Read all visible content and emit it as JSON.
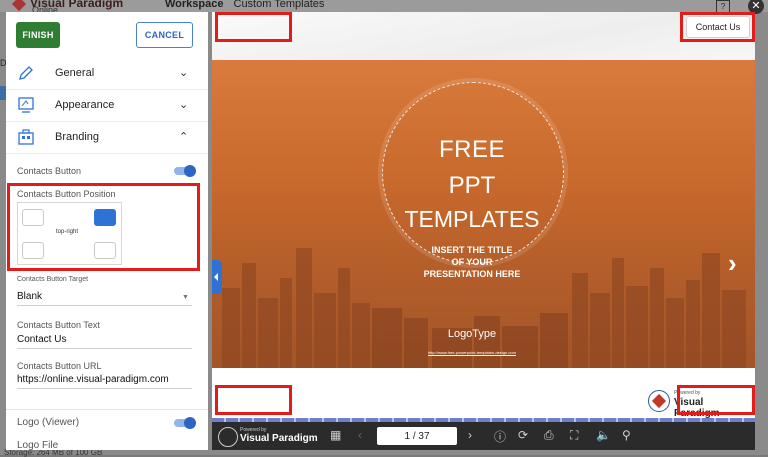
{
  "background": {
    "logo_name": "Visual Paradigm",
    "logo_sub": "Online",
    "workspace_label": "Workspace",
    "crumb": "Custom Templates",
    "help": "?",
    "close": "✕",
    "storage": "Storage: 264 MB of 100 GB",
    "left_letter": "D"
  },
  "panel": {
    "finish_label": "FINISH",
    "cancel_label": "CANCEL",
    "sections": {
      "general": "General",
      "appearance": "Appearance",
      "branding": "Branding"
    },
    "contacts_button_label": "Contacts Button",
    "contacts_button_on": true,
    "position_label": "Contacts Button Position",
    "position_value": "top-right",
    "target_label": "Contacts Button Target",
    "target_value": "Blank",
    "text_label": "Contacts Button Text",
    "text_value": "Contact Us",
    "url_label": "Contacts Button URL",
    "url_value": "https://online.visual-paradigm.com",
    "logo_viewer_label": "Logo (Viewer)",
    "logo_viewer_on": true,
    "logo_file_label": "Logo File"
  },
  "viewer": {
    "contact_button": "Contact Us",
    "slide": {
      "free": "FREE",
      "ppt": "PPT",
      "templates": "TEMPLATES",
      "insert_line1": "INSERT THE TITLE",
      "insert_line2": "OF YOUR",
      "insert_line3": "PRESENTATION HERE",
      "logotype": "LogoType",
      "url": "http://www.free-powerpoint-templates-design.com"
    },
    "badge": {
      "powered": "Powered by",
      "name": "Visual Paradigm"
    },
    "toolbar": {
      "powered": "Powered by",
      "name": "Visual Paradigm",
      "page": "1 / 37"
    }
  },
  "colors": {
    "finish_green": "#2e7d32",
    "accent_blue": "#2f72d5",
    "highlight_red": "#e41b1b",
    "slide_orange": "#c8692c"
  }
}
